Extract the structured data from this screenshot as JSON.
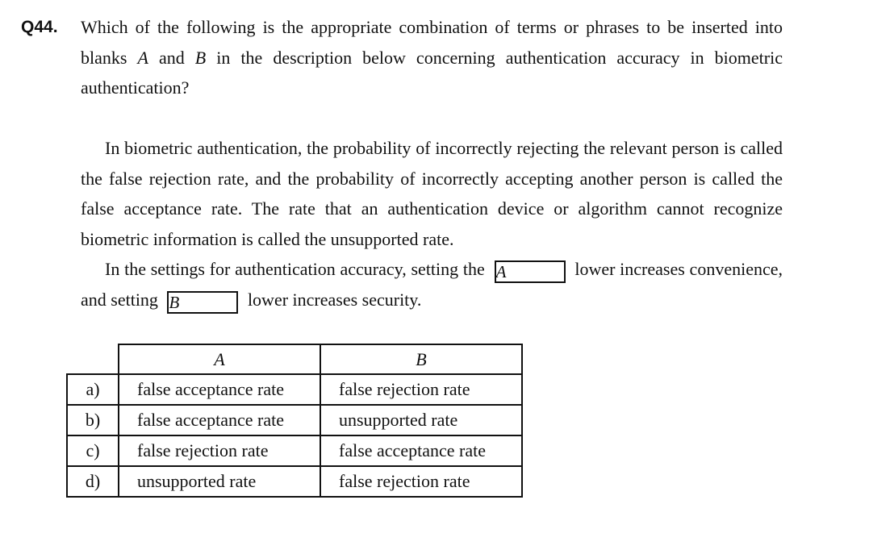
{
  "question": {
    "number": "Q44.",
    "text_before_a": "Which of the following is the appropriate combination of terms or phrases to be inserted into blanks ",
    "blank_a": "A",
    "text_and": " and ",
    "blank_b": "B",
    "text_after_b": " in the description below concerning authentication accuracy in biometric authentication?"
  },
  "passage": {
    "paragraph1": "In biometric authentication, the probability of incorrectly rejecting the relevant person is called the false rejection rate, and the probability of incorrectly accepting another person is called the false acceptance rate. The rate that an authentication device or algorithm cannot recognize biometric information is called the unsupported rate.",
    "p2_part1": "In the settings for authentication accuracy, setting the",
    "p2_blank1": "A",
    "p2_part2": "lower increases convenience, and setting",
    "p2_blank2": "B",
    "p2_part3": "lower increases security."
  },
  "answer_table": {
    "header_a": "A",
    "header_b": "B",
    "rows": [
      {
        "option": "a)",
        "a": "false acceptance rate",
        "b": "false rejection rate"
      },
      {
        "option": "b)",
        "a": "false acceptance rate",
        "b": "unsupported rate"
      },
      {
        "option": "c)",
        "a": "false rejection rate",
        "b": "false acceptance rate"
      },
      {
        "option": "d)",
        "a": "unsupported rate",
        "b": "false rejection rate"
      }
    ]
  }
}
